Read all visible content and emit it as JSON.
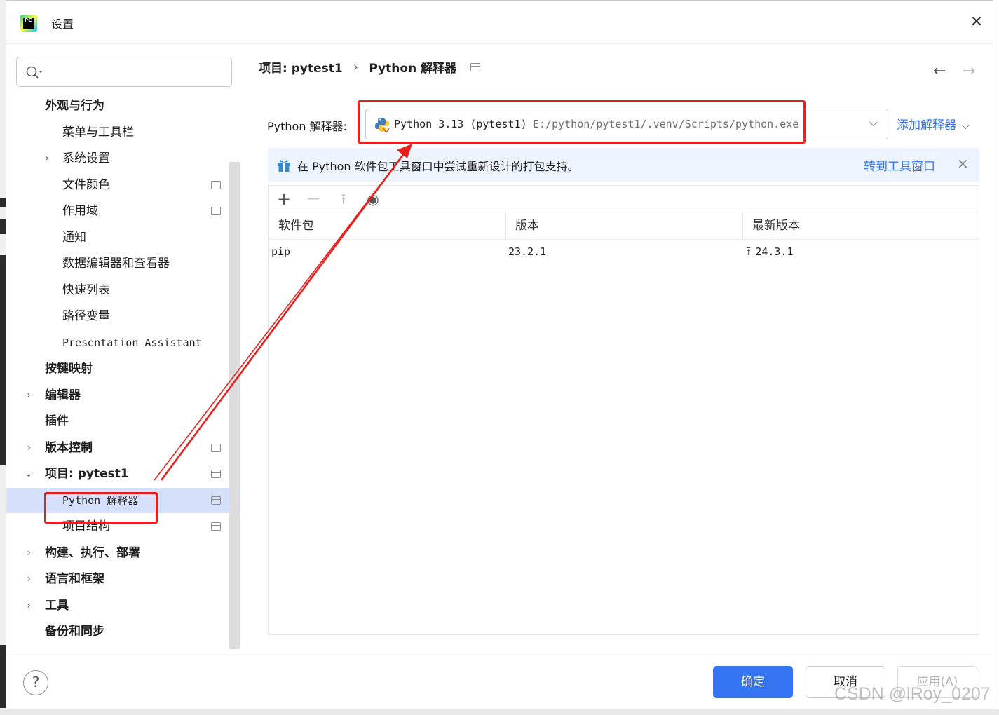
{
  "window": {
    "title": "设置",
    "close_label": "✕"
  },
  "search": {
    "placeholder": "",
    "value": ""
  },
  "tree": [
    {
      "label": "外观与行为",
      "bold": true,
      "indent": 0,
      "chevron": "",
      "pinned": false,
      "selected": false
    },
    {
      "label": "菜单与工具栏",
      "bold": false,
      "indent": 1,
      "chevron": "",
      "pinned": false,
      "selected": false
    },
    {
      "label": "系统设置",
      "bold": false,
      "indent": 1,
      "chevron": "›",
      "pinned": false,
      "selected": false
    },
    {
      "label": "文件颜色",
      "bold": false,
      "indent": 1,
      "chevron": "",
      "pinned": true,
      "selected": false
    },
    {
      "label": "作用域",
      "bold": false,
      "indent": 1,
      "chevron": "",
      "pinned": true,
      "selected": false
    },
    {
      "label": "通知",
      "bold": false,
      "indent": 1,
      "chevron": "",
      "pinned": false,
      "selected": false
    },
    {
      "label": "数据编辑器和查看器",
      "bold": false,
      "indent": 1,
      "chevron": "",
      "pinned": false,
      "selected": false
    },
    {
      "label": "快速列表",
      "bold": false,
      "indent": 1,
      "chevron": "",
      "pinned": false,
      "selected": false
    },
    {
      "label": "路径变量",
      "bold": false,
      "indent": 1,
      "chevron": "",
      "pinned": false,
      "selected": false
    },
    {
      "label": "Presentation Assistant",
      "bold": false,
      "indent": 1,
      "chevron": "",
      "pinned": false,
      "selected": false
    },
    {
      "label": "按键映射",
      "bold": true,
      "indent": 0,
      "chevron": "",
      "pinned": false,
      "selected": false
    },
    {
      "label": "编辑器",
      "bold": true,
      "indent": 0,
      "chevron": "›",
      "pinned": false,
      "selected": false
    },
    {
      "label": "插件",
      "bold": true,
      "indent": 0,
      "chevron": "",
      "pinned": false,
      "selected": false
    },
    {
      "label": "版本控制",
      "bold": true,
      "indent": 0,
      "chevron": "›",
      "pinned": true,
      "selected": false
    },
    {
      "label": "项目: pytest1",
      "bold": true,
      "indent": 0,
      "chevron": "⌄",
      "pinned": true,
      "selected": false
    },
    {
      "label": "Python 解释器",
      "bold": false,
      "indent": 1,
      "chevron": "",
      "pinned": true,
      "selected": true
    },
    {
      "label": "项目结构",
      "bold": false,
      "indent": 1,
      "chevron": "",
      "pinned": true,
      "selected": false
    },
    {
      "label": "构建、执行、部署",
      "bold": true,
      "indent": 0,
      "chevron": "›",
      "pinned": false,
      "selected": false
    },
    {
      "label": "语言和框架",
      "bold": true,
      "indent": 0,
      "chevron": "›",
      "pinned": false,
      "selected": false
    },
    {
      "label": "工具",
      "bold": true,
      "indent": 0,
      "chevron": "›",
      "pinned": false,
      "selected": false
    },
    {
      "label": "备份和同步",
      "bold": true,
      "indent": 0,
      "chevron": "",
      "pinned": false,
      "selected": false
    }
  ],
  "breadcrumb": {
    "project": "项目: pytest1",
    "separator": "›",
    "page": "Python 解释器"
  },
  "nav": {
    "back": "←",
    "forward": "→"
  },
  "interpreter": {
    "label": "Python 解释器:",
    "name": "Python 3.13 (pytest1)",
    "path": "E:/python/pytest1/.venv/Scripts/python.exe",
    "add_label": "添加解释器"
  },
  "banner": {
    "text": "在 Python 软件包工具窗口中尝试重新设计的打包支持。",
    "link": "转到工具窗口",
    "close": "✕"
  },
  "toolbar": {
    "add": "+",
    "remove": "—",
    "upgrade": "⭱",
    "show": "◉"
  },
  "packages": {
    "columns": [
      "软件包",
      "版本",
      "最新版本"
    ],
    "rows": [
      {
        "name": "pip",
        "version": "23.2.1",
        "latest": "24.3.1"
      }
    ]
  },
  "footer": {
    "help": "?",
    "ok": "确定",
    "cancel": "取消",
    "apply": "应用(A)"
  },
  "watermark": "CSDN @lRoy_0207",
  "colors": {
    "accent": "#3574f0",
    "annotation": "#e8201d",
    "selection": "#d5e1fa",
    "banner": "#eef4fe"
  }
}
